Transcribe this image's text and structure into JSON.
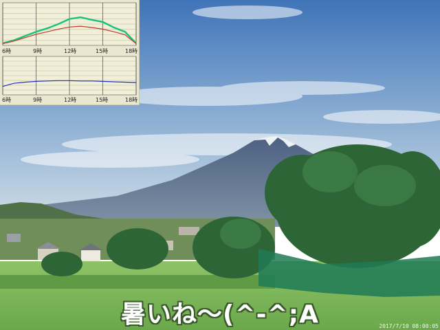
{
  "caption": "暑いね〜(^-^;A",
  "timestamp": "2017/7/10 08:00:05",
  "icons": [
    "mountain-fuji",
    "tree-cluster",
    "green-net"
  ],
  "colors": {
    "sky_top": "#4f7fbf",
    "sky_bottom": "#c9dbe8",
    "mountain": "#5b6f8e",
    "forest": "#2f6a3a",
    "grass": "#7bb25a",
    "chart_bg": "#e9e7cf",
    "chart_top_green": "#19c27a",
    "chart_top_red": "#c0392b",
    "chart_bottom_blue": "#1f2fbf",
    "caption_text": "#ffffff"
  },
  "chart_data": [
    {
      "type": "line",
      "title": "",
      "xlabel": "",
      "ylabel": "",
      "x_ticks": [
        "6時",
        "9時",
        "12時",
        "15時",
        "18時"
      ],
      "xlim": [
        6,
        18
      ],
      "ylim": [
        0,
        1
      ],
      "grid": true,
      "series": [
        {
          "color": "#19c27a",
          "x": [
            6,
            7,
            8,
            9,
            10,
            11,
            12,
            13,
            14,
            15,
            16,
            17,
            18
          ],
          "values": [
            0.05,
            0.12,
            0.22,
            0.32,
            0.4,
            0.5,
            0.62,
            0.66,
            0.6,
            0.55,
            0.42,
            0.32,
            0.05
          ]
        },
        {
          "color": "#c0392b",
          "x": [
            6,
            7,
            8,
            9,
            10,
            11,
            12,
            13,
            14,
            15,
            16,
            17,
            18
          ],
          "values": [
            0.04,
            0.1,
            0.18,
            0.26,
            0.32,
            0.38,
            0.43,
            0.45,
            0.42,
            0.38,
            0.32,
            0.25,
            0.04
          ]
        }
      ]
    },
    {
      "type": "line",
      "title": "",
      "xlabel": "",
      "ylabel": "",
      "x_ticks": [
        "6時",
        "9時",
        "12時",
        "15時",
        "18時"
      ],
      "xlim": [
        6,
        18
      ],
      "ylim": [
        0,
        1
      ],
      "grid": true,
      "series": [
        {
          "color": "#1f2fbf",
          "x": [
            6,
            7,
            8,
            9,
            10,
            11,
            12,
            13,
            14,
            15,
            16,
            17,
            18
          ],
          "values": [
            0.22,
            0.3,
            0.33,
            0.35,
            0.36,
            0.37,
            0.37,
            0.36,
            0.36,
            0.35,
            0.34,
            0.33,
            0.32
          ]
        }
      ]
    }
  ]
}
